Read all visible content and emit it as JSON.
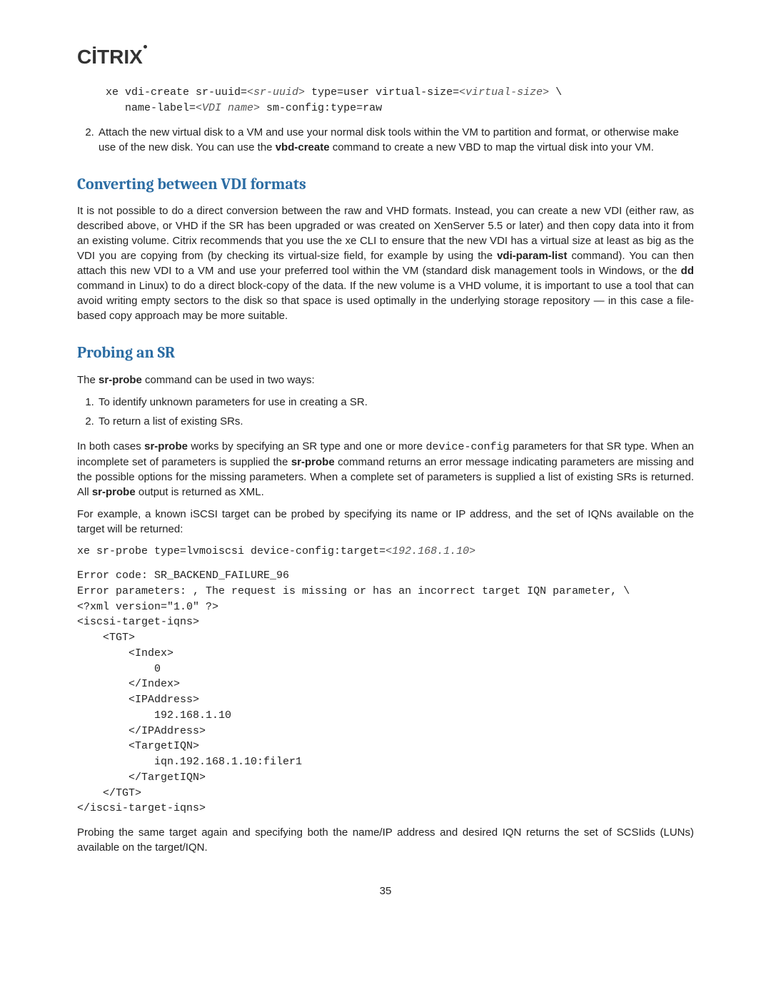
{
  "logo": "CITRIX",
  "code1": {
    "line1_a": "xe vdi-create sr-uuid=",
    "line1_arg1": "<sr-uuid>",
    "line1_b": " type=user virtual-size=",
    "line1_arg2": "<virtual-size>",
    "line1_c": " \\",
    "line2_a": "   name-label=",
    "line2_arg1": "<VDI name>",
    "line2_b": " sm-config:type=raw"
  },
  "step2_a": "Attach the new virtual disk to a VM and use your normal disk tools within the VM to partition and format, or otherwise make use of the new disk. You can use the ",
  "step2_b": "vbd-create",
  "step2_c": " command to create a new VBD to map the virtual disk into your VM.",
  "sec1_title": "Converting between VDI formats",
  "sec1_p_a": "It is not possible to do a direct conversion between the raw and VHD formats. Instead, you can create a new VDI (either raw, as described above, or VHD if the SR has been upgraded or was created on XenServer 5.5 or later) and then copy data into it from an existing volume. Citrix recommends that you use the xe CLI to ensure that the new VDI has a virtual size at least as big as the VDI you are copying from (by checking its virtual-size field, for example by using the ",
  "sec1_p_b": "vdi-param-list",
  "sec1_p_c": " command). You can then attach this new VDI to a VM and use your preferred tool within the VM (standard disk management tools in Windows, or the ",
  "sec1_p_d": "dd",
  "sec1_p_e": " command in Linux) to do a direct block-copy of the data. If the new volume is a VHD volume, it is important to use a tool that can avoid writing empty sectors to the disk so that space is used optimally in the underlying storage repository — in this case a file-based copy approach may be more suitable.",
  "sec2_title": "Probing an SR",
  "sec2_p1_a": "The ",
  "sec2_p1_b": "sr-probe",
  "sec2_p1_c": " command can be used in two ways:",
  "sec2_li1": "To identify unknown parameters for use in creating a SR.",
  "sec2_li2": "To return a list of existing SRs.",
  "sec2_p2_a": "In both cases ",
  "sec2_p2_b": "sr-probe",
  "sec2_p2_c": " works by specifying an SR type and one or more ",
  "sec2_p2_d": "device-config",
  "sec2_p2_e": " parameters for that SR type. When an incomplete set of parameters is supplied the ",
  "sec2_p2_f": "sr-probe",
  "sec2_p2_g": " command returns an error message indicating parameters are missing and the possible options for the missing parameters. When a complete set of parameters is supplied a list of existing SRs is returned. All ",
  "sec2_p2_h": "sr-probe",
  "sec2_p2_i": " output is returned as XML.",
  "sec2_p3": "For example, a known iSCSI target can be probed by specifying its name or IP address, and the set of IQNs available on the target will be returned:",
  "code2_a": "xe sr-probe type=lvmoiscsi device-config:target=",
  "code2_arg": "<192.168.1.10>",
  "code3": "Error code: SR_BACKEND_FAILURE_96\nError parameters: , The request is missing or has an incorrect target IQN parameter, \\\n<?xml version=\"1.0\" ?>\n<iscsi-target-iqns>\n    <TGT>\n        <Index>\n            0\n        </Index>\n        <IPAddress>\n            192.168.1.10\n        </IPAddress>\n        <TargetIQN>\n            iqn.192.168.1.10:filer1\n        </TargetIQN>\n    </TGT>\n</iscsi-target-iqns>",
  "sec2_p4": "Probing the same target again and specifying both the name/IP address and desired IQN returns the set of SCSIids (LUNs) available on the target/IQN.",
  "page_num": "35"
}
